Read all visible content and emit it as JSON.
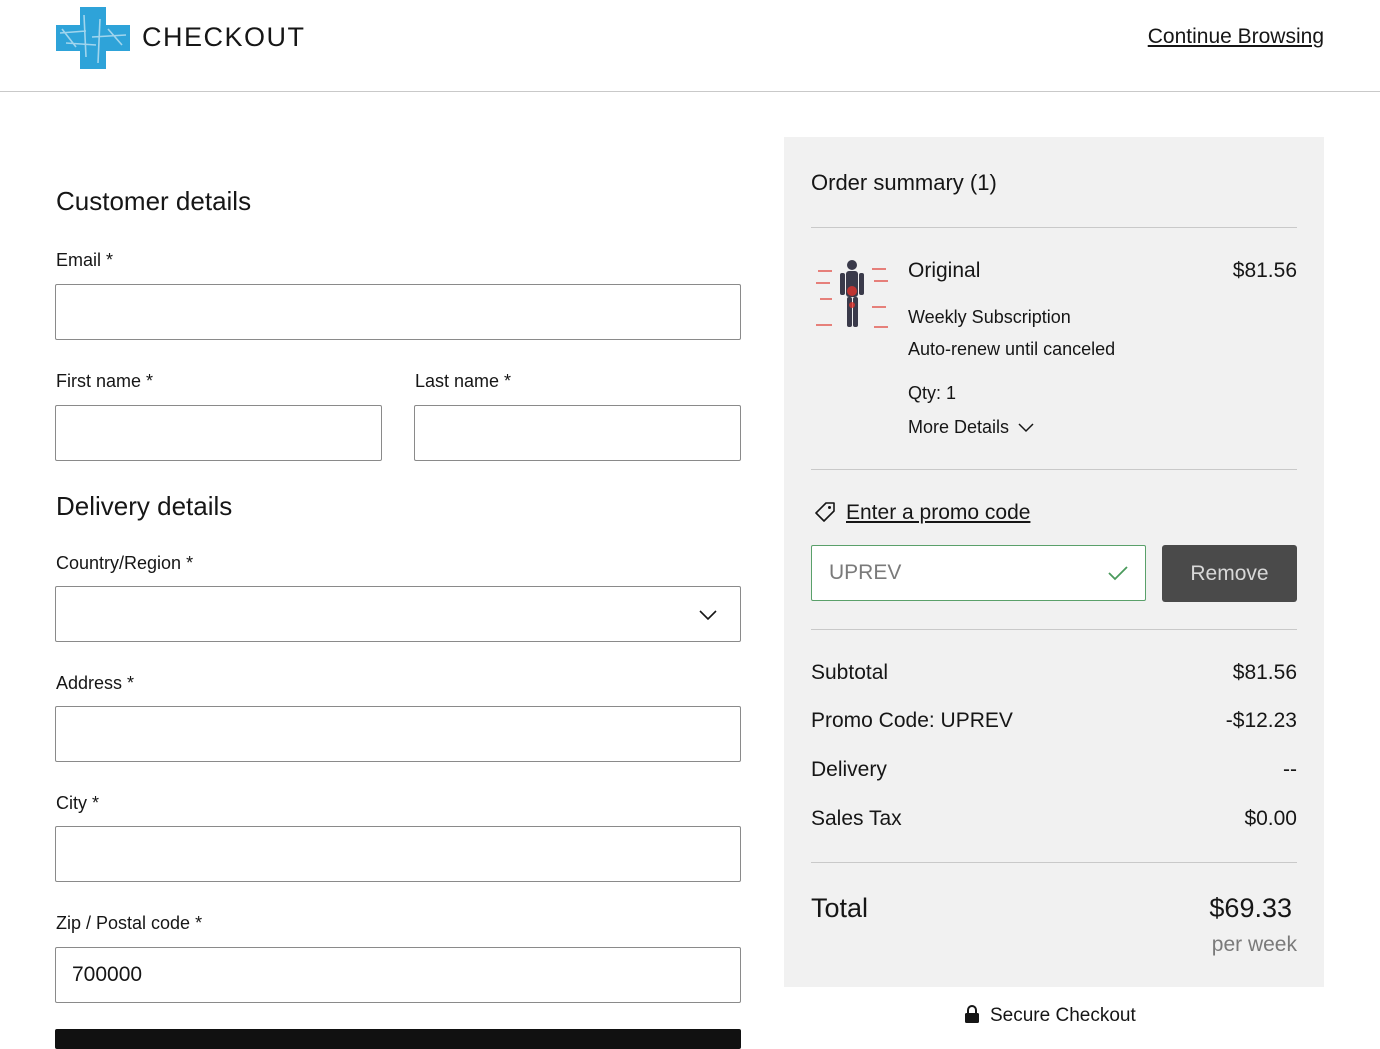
{
  "header": {
    "brand": "CHECKOUT",
    "continue_link": "Continue Browsing"
  },
  "customer": {
    "title": "Customer details",
    "email_label": "Email *",
    "email_value": "",
    "first_name_label": "First name *",
    "first_name_value": "",
    "last_name_label": "Last name *",
    "last_name_value": ""
  },
  "delivery": {
    "title": "Delivery details",
    "country_label": "Country/Region *",
    "country_value": "",
    "address_label": "Address *",
    "address_value": "",
    "city_label": "City *",
    "city_value": "",
    "zip_label": "Zip / Postal code *",
    "zip_value": "700000"
  },
  "summary": {
    "title": "Order summary (1)",
    "item": {
      "name": "Original",
      "price": "$81.56",
      "line1": "Weekly Subscription",
      "line2": "Auto-renew until canceled",
      "qty": "Qty: 1",
      "more": "More Details"
    },
    "promo_link": "Enter a promo code",
    "promo_value": "UPREV",
    "remove_label": "Remove",
    "rows": [
      {
        "label": "Subtotal",
        "value": "$81.56"
      },
      {
        "label": "Promo Code: UPREV",
        "value": "-$12.23"
      },
      {
        "label": "Delivery",
        "value": "--"
      },
      {
        "label": "Sales Tax",
        "value": "$0.00"
      }
    ],
    "total_label": "Total",
    "total_value": "$69.33",
    "per_week": "per week"
  },
  "secure_label": "Secure Checkout",
  "colors": {
    "accent_logo": "#2ea3d9",
    "summary_bg": "#f1f1f1",
    "promo_valid_border": "#5aa06a",
    "remove_button_bg": "#4a4a4a"
  }
}
